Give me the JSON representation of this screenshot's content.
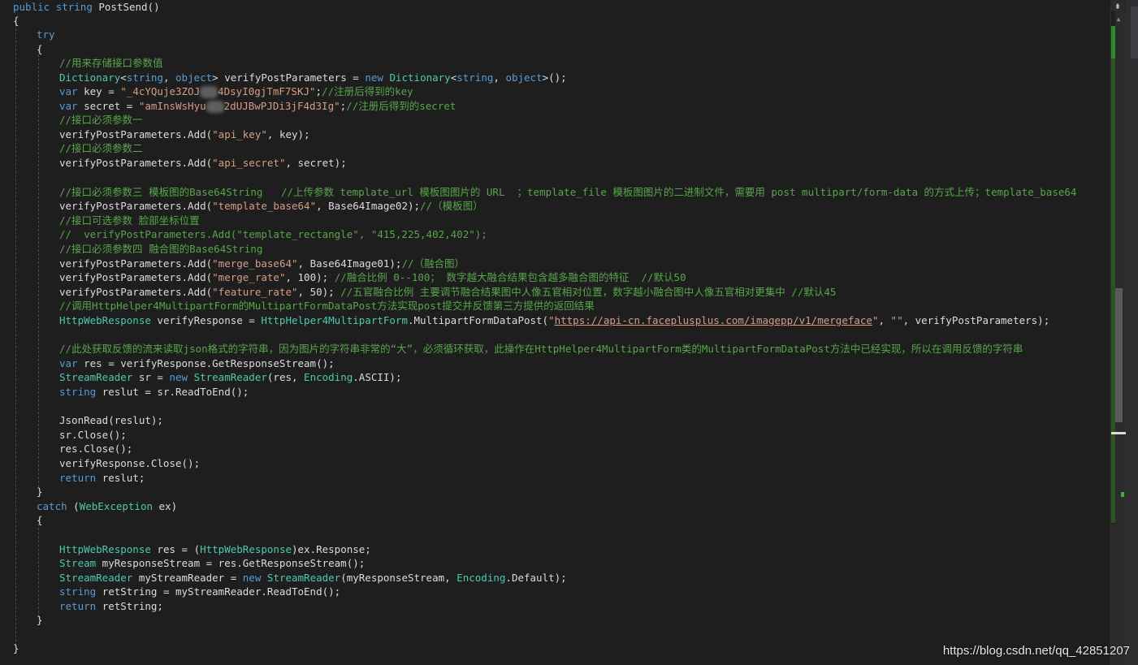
{
  "editor": {
    "lines": [
      {
        "t": 0,
        "ind": 0,
        "segs": [
          [
            "kw",
            "public "
          ],
          [
            "kw",
            "string "
          ],
          [
            "tx",
            "PostSend()"
          ]
        ]
      },
      {
        "t": 17,
        "ind": 0,
        "segs": [
          [
            "tx",
            "{"
          ]
        ]
      },
      {
        "t": 34,
        "ind": 1,
        "segs": [
          [
            "kw",
            "try"
          ]
        ]
      },
      {
        "t": 52,
        "ind": 1,
        "segs": [
          [
            "tx",
            "{"
          ]
        ]
      },
      {
        "t": 69,
        "ind": 2,
        "segs": [
          [
            "cm",
            "//用来存储接口参数值"
          ]
        ]
      },
      {
        "t": 87,
        "ind": 2,
        "segs": [
          [
            "ty",
            "Dictionary"
          ],
          [
            "tx",
            "<"
          ],
          [
            "kw",
            "string"
          ],
          [
            "tx",
            ", "
          ],
          [
            "kw",
            "object"
          ],
          [
            "tx",
            "> verifyPostParameters = "
          ],
          [
            "kw",
            "new "
          ],
          [
            "ty",
            "Dictionary"
          ],
          [
            "tx",
            "<"
          ],
          [
            "kw",
            "string"
          ],
          [
            "tx",
            ", "
          ],
          [
            "kw",
            "object"
          ],
          [
            "tx",
            ">();"
          ]
        ]
      },
      {
        "t": 104,
        "ind": 2,
        "segs": [
          [
            "kw",
            "var "
          ],
          [
            "tx",
            "key = "
          ],
          [
            "str",
            "\"_4cYQuje3ZOJ"
          ],
          [
            "blur",
            ""
          ],
          [
            "str",
            "4DsyI0gjTmF7SKJ\""
          ],
          [
            "tx",
            ";"
          ],
          [
            "cm",
            "//注册后得到的key"
          ]
        ]
      },
      {
        "t": 122,
        "ind": 2,
        "segs": [
          [
            "kw",
            "var "
          ],
          [
            "tx",
            "secret = "
          ],
          [
            "str",
            "\"amInsWsHyu"
          ],
          [
            "blur",
            ""
          ],
          [
            "str",
            "2dUJBwPJDi3jF4d3Ig\""
          ],
          [
            "tx",
            ";"
          ],
          [
            "cm",
            "//注册后得到的secret"
          ]
        ]
      },
      {
        "t": 139,
        "ind": 2,
        "segs": [
          [
            "cm",
            "//接口必须参数一"
          ]
        ]
      },
      {
        "t": 157,
        "ind": 2,
        "segs": [
          [
            "tx",
            "verifyPostParameters.Add("
          ],
          [
            "str",
            "\"api_key\""
          ],
          [
            "tx",
            ", key);"
          ]
        ]
      },
      {
        "t": 174,
        "ind": 2,
        "segs": [
          [
            "cm",
            "//接口必须参数二"
          ]
        ]
      },
      {
        "t": 192,
        "ind": 2,
        "segs": [
          [
            "tx",
            "verifyPostParameters.Add("
          ],
          [
            "str",
            "\"api_secret\""
          ],
          [
            "tx",
            ", secret);"
          ]
        ]
      },
      {
        "t": 228,
        "ind": 2,
        "segs": [
          [
            "cm",
            "//接口必须参数三 模板图的Base64String   //上传参数 template_url 模板图图片的 URL  ；template_file 模板图图片的二进制文件，需要用 post multipart/form-data 的方式上传；template_base64"
          ]
        ]
      },
      {
        "t": 245,
        "ind": 2,
        "segs": [
          [
            "tx",
            "verifyPostParameters.Add("
          ],
          [
            "str",
            "\"template_base64\""
          ],
          [
            "tx",
            ", Base64Image02);"
          ],
          [
            "cm",
            "//（模板图）"
          ]
        ]
      },
      {
        "t": 263,
        "ind": 2,
        "segs": [
          [
            "cm",
            "//接口可选参数 脸部坐标位置"
          ]
        ]
      },
      {
        "t": 280,
        "ind": 2,
        "segs": [
          [
            "cm",
            "//  verifyPostParameters.Add(\"template_rectangle\", \"415,225,402,402\");"
          ]
        ]
      },
      {
        "t": 298,
        "ind": 2,
        "segs": [
          [
            "cm",
            "//接口必须参数四 融合图的Base64String"
          ]
        ]
      },
      {
        "t": 316,
        "ind": 2,
        "segs": [
          [
            "tx",
            "verifyPostParameters.Add("
          ],
          [
            "str",
            "\"merge_base64\""
          ],
          [
            "tx",
            ", Base64Image01);"
          ],
          [
            "cm",
            "//（融合图）"
          ]
        ]
      },
      {
        "t": 333,
        "ind": 2,
        "segs": [
          [
            "tx",
            "verifyPostParameters.Add("
          ],
          [
            "str",
            "\"merge_rate\""
          ],
          [
            "tx",
            ", 100); "
          ],
          [
            "cm",
            "//融合比例 0--100； 数字越大融合结果包含越多融合图的特征  //默认50"
          ]
        ]
      },
      {
        "t": 351,
        "ind": 2,
        "segs": [
          [
            "tx",
            "verifyPostParameters.Add("
          ],
          [
            "str",
            "\"feature_rate\""
          ],
          [
            "tx",
            ", 50); "
          ],
          [
            "cm",
            "//五官融合比例 主要调节融合结果图中人像五官相对位置，数字越小融合图中人像五官相对更集中 //默认45"
          ]
        ]
      },
      {
        "t": 368,
        "ind": 2,
        "segs": [
          [
            "cm",
            "//调用HttpHelper4MultipartForm的MultipartFormDataPost方法实现post提交并反馈第三方提供的返回结果"
          ]
        ]
      },
      {
        "t": 386,
        "ind": 2,
        "segs": [
          [
            "ty",
            "HttpWebResponse"
          ],
          [
            "tx",
            " verifyResponse = "
          ],
          [
            "ty",
            "HttpHelper4MultipartForm"
          ],
          [
            "tx",
            ".MultipartFormDataPost("
          ],
          [
            "str",
            "\""
          ],
          [
            "lnk",
            "https://api-cn.faceplusplus.com/imagepp/v1/mergeface"
          ],
          [
            "str",
            "\""
          ],
          [
            "tx",
            ", "
          ],
          [
            "str",
            "\"\""
          ],
          [
            "tx",
            ", verifyPostParameters);"
          ]
        ]
      },
      {
        "t": 421,
        "ind": 2,
        "segs": [
          [
            "cm",
            "//此处获取反馈的流来读取json格式的字符串，因为图片的字符串非常的“大”，必须循环获取，此操作在HttpHelper4MultipartForm类的MultipartFormDataPost方法中已经实现，所以在调用反馈的字符串"
          ]
        ]
      },
      {
        "t": 439,
        "ind": 2,
        "segs": [
          [
            "kw",
            "var "
          ],
          [
            "tx",
            "res = verifyResponse.GetResponseStream();"
          ]
        ]
      },
      {
        "t": 456,
        "ind": 2,
        "segs": [
          [
            "ty",
            "StreamReader"
          ],
          [
            "tx",
            " sr = "
          ],
          [
            "kw",
            "new "
          ],
          [
            "ty",
            "StreamReader"
          ],
          [
            "tx",
            "(res, "
          ],
          [
            "ty",
            "Encoding"
          ],
          [
            "tx",
            ".ASCII);"
          ]
        ]
      },
      {
        "t": 474,
        "ind": 2,
        "segs": [
          [
            "kw",
            "string "
          ],
          [
            "tx",
            "reslut = sr.ReadToEnd();"
          ]
        ]
      },
      {
        "t": 509,
        "ind": 2,
        "segs": [
          [
            "tx",
            "JsonRead(reslut);"
          ]
        ]
      },
      {
        "t": 527,
        "ind": 2,
        "segs": [
          [
            "tx",
            "sr.Close();"
          ]
        ]
      },
      {
        "t": 544,
        "ind": 2,
        "segs": [
          [
            "tx",
            "res.Close();"
          ]
        ]
      },
      {
        "t": 562,
        "ind": 2,
        "segs": [
          [
            "tx",
            "verifyResponse.Close();"
          ]
        ]
      },
      {
        "t": 580,
        "ind": 2,
        "segs": [
          [
            "kw",
            "return "
          ],
          [
            "tx",
            "reslut;"
          ]
        ]
      },
      {
        "t": 597,
        "ind": 1,
        "segs": [
          [
            "tx",
            "}"
          ]
        ]
      },
      {
        "t": 615,
        "ind": 1,
        "segs": [
          [
            "kw",
            "catch "
          ],
          [
            "tx",
            "("
          ],
          [
            "ty",
            "WebException"
          ],
          [
            "tx",
            " ex)"
          ]
        ]
      },
      {
        "t": 632,
        "ind": 1,
        "segs": [
          [
            "tx",
            "{"
          ]
        ]
      },
      {
        "t": 668,
        "ind": 2,
        "segs": [
          [
            "ty",
            "HttpWebResponse"
          ],
          [
            "tx",
            " res = ("
          ],
          [
            "ty",
            "HttpWebResponse"
          ],
          [
            "tx",
            ")ex.Response;"
          ]
        ]
      },
      {
        "t": 685,
        "ind": 2,
        "segs": [
          [
            "ty",
            "Stream"
          ],
          [
            "tx",
            " myResponseStream = res.GetResponseStream();"
          ]
        ]
      },
      {
        "t": 703,
        "ind": 2,
        "segs": [
          [
            "ty",
            "StreamReader"
          ],
          [
            "tx",
            " myStreamReader = "
          ],
          [
            "kw",
            "new "
          ],
          [
            "ty",
            "StreamReader"
          ],
          [
            "tx",
            "(myResponseStream, "
          ],
          [
            "ty",
            "Encoding"
          ],
          [
            "tx",
            ".Default);"
          ]
        ]
      },
      {
        "t": 720,
        "ind": 2,
        "segs": [
          [
            "kw",
            "string "
          ],
          [
            "tx",
            "retString = myStreamReader.ReadToEnd();"
          ]
        ]
      },
      {
        "t": 738,
        "ind": 2,
        "segs": [
          [
            "kw",
            "return "
          ],
          [
            "tx",
            "retString;"
          ]
        ]
      },
      {
        "t": 755,
        "ind": 1,
        "segs": [
          [
            "tx",
            "}"
          ]
        ]
      },
      {
        "t": 790,
        "ind": 0,
        "segs": [
          [
            "tx",
            "}"
          ]
        ]
      }
    ]
  },
  "scrollbar": {
    "split_icon": "split-view-icon",
    "arrow_icon": "scroll-up-arrow-icon",
    "split_glyph": "⇞",
    "arrow_glyph": "▲"
  },
  "watermark": {
    "text": "https://blog.csdn.net/qq_42851207"
  },
  "colors": {
    "keyword": "#569cd6",
    "type": "#4ec9b0",
    "string": "#d69d85",
    "comment": "#57a64a",
    "text": "#dcdcdc",
    "background": "#1e1e1e"
  }
}
